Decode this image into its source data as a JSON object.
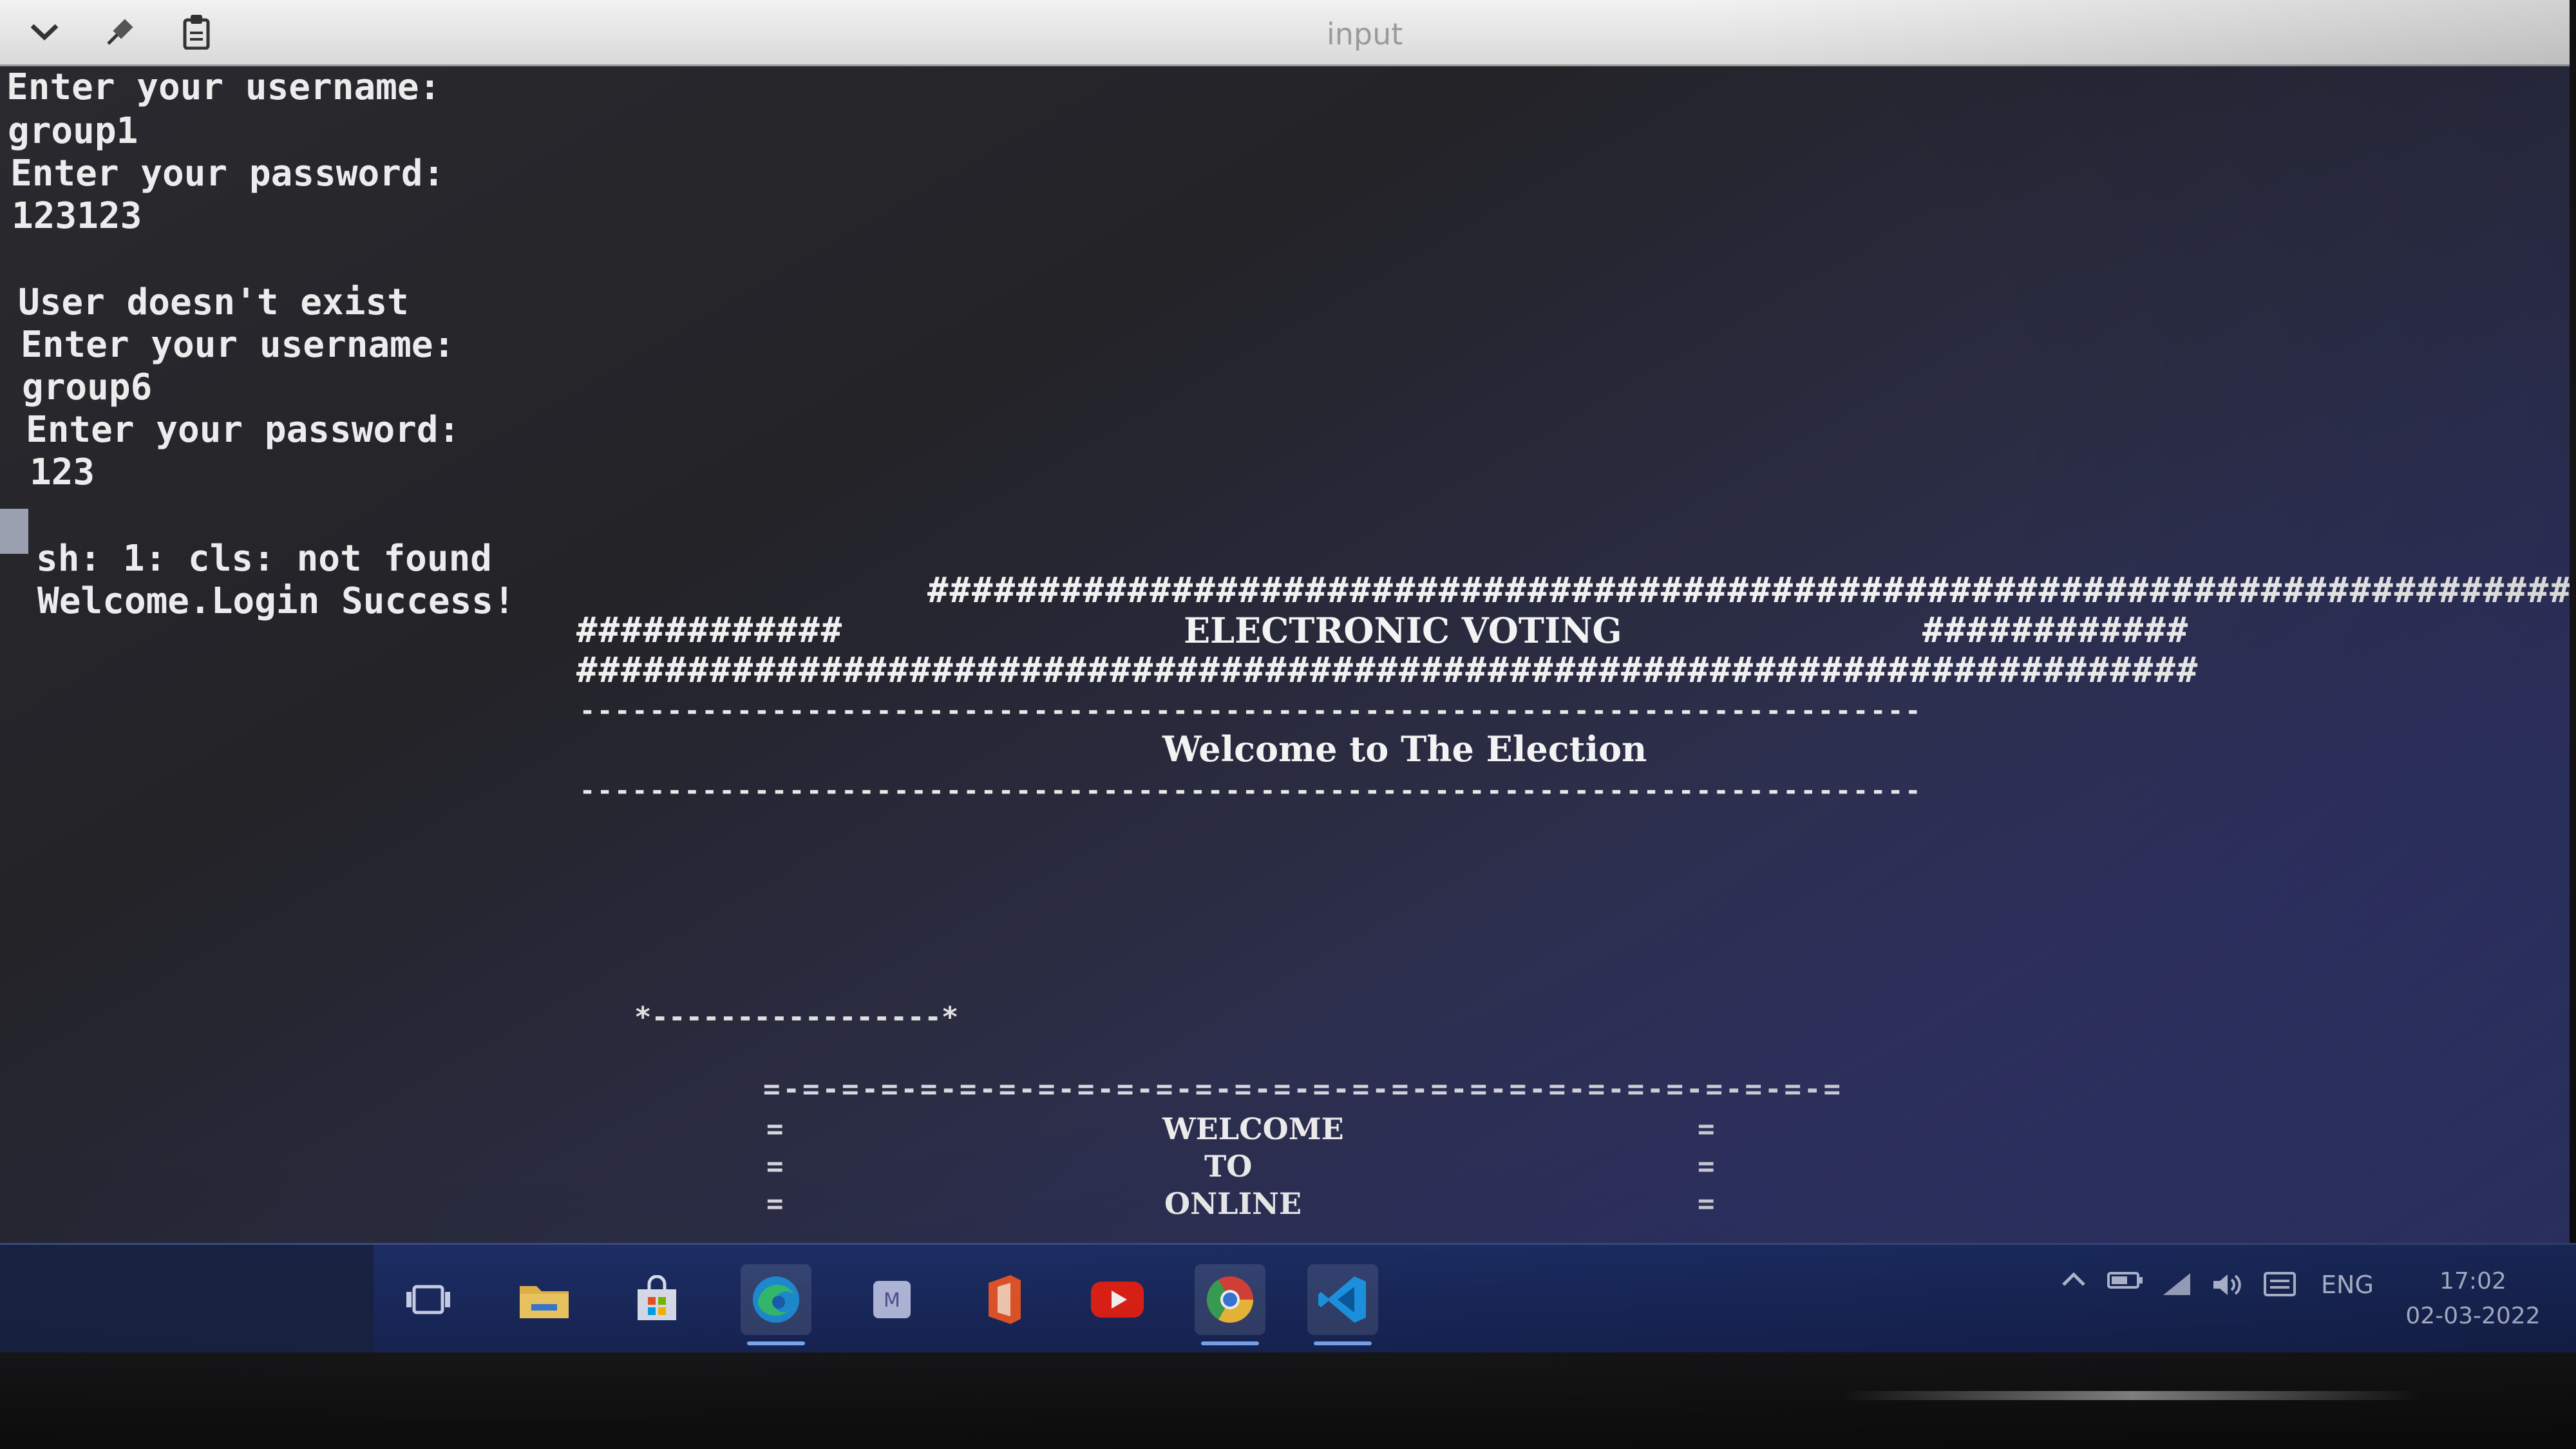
{
  "window": {
    "title": "input"
  },
  "terminal": {
    "lines": [
      "Enter your username:",
      "group1",
      "Enter your password:",
      "123123",
      "",
      "User doesn't exist",
      "Enter your username:",
      "group6",
      "Enter your password:",
      "123",
      "",
      "sh: 1: cls: not found",
      "Welcome.Login Success!"
    ],
    "banner": {
      "hash_row_top": "###################################################################################",
      "hash_left": "############",
      "title": "ELECTRONIC VOTING",
      "hash_right": "############",
      "hash_row_bottom": "#########################################################################",
      "dash_row": "-----------------------------------------------------------------------------",
      "welcome": "Welcome to The Election",
      "small_dash": "*-----------------*",
      "box_top": "=-=-=-=-=-=-=-=-=-=-=-=-=-=-=-=-=-=-=-=-=-=-=-=-=-=-=-=",
      "box_side": "=",
      "box_lines": [
        "WELCOME",
        "TO",
        "ONLINE"
      ]
    }
  },
  "taskbar": {
    "apps": [
      {
        "name": "task-view",
        "icon": "task-view-icon"
      },
      {
        "name": "file-explorer",
        "icon": "folder-icon"
      },
      {
        "name": "microsoft-store",
        "icon": "store-icon"
      },
      {
        "name": "edge",
        "icon": "edge-icon"
      },
      {
        "name": "app-m",
        "icon": "app-icon"
      },
      {
        "name": "office",
        "icon": "office-icon"
      },
      {
        "name": "youtube",
        "icon": "youtube-icon"
      },
      {
        "name": "chrome",
        "icon": "chrome-icon"
      },
      {
        "name": "vscode",
        "icon": "vscode-icon"
      }
    ],
    "tray": {
      "language": "ENG"
    },
    "clock": {
      "time": "17:02",
      "date": "02-03-2022"
    }
  },
  "colors": {
    "taskbar": "#1d2f68",
    "terminal_text": "#ececec",
    "accent": "#7fb0ff"
  }
}
